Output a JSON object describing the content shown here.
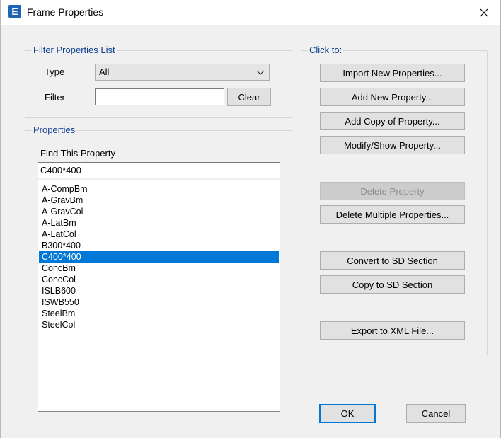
{
  "window": {
    "title": "Frame Properties",
    "app_icon_letter": "E",
    "accent_color": "#0078d7",
    "title_color": "#0b3f91"
  },
  "filter": {
    "group_label": "Filter Properties List",
    "type_label": "Type",
    "type_value": "All",
    "filter_label": "Filter",
    "filter_value": "",
    "clear_label": "Clear"
  },
  "properties": {
    "group_label": "Properties",
    "find_label": "Find This Property",
    "find_value": "C400*400",
    "items": [
      "A-CompBm",
      "A-GravBm",
      "A-GravCol",
      "A-LatBm",
      "A-LatCol",
      "B300*400",
      "C400*400",
      "ConcBm",
      "ConcCol",
      "ISLB600",
      "ISWB550",
      "SteelBm",
      "SteelCol"
    ],
    "selected": "C400*400"
  },
  "actions": {
    "group_label": "Click to:",
    "import": "Import New Properties...",
    "add_new": "Add New Property...",
    "add_copy": "Add Copy of Property...",
    "modify": "Modify/Show Property...",
    "delete": "Delete Property",
    "delete_multiple": "Delete Multiple Properties...",
    "convert_sd": "Convert to SD Section",
    "copy_sd": "Copy to SD Section",
    "export_xml": "Export to XML File..."
  },
  "footer": {
    "ok": "OK",
    "cancel": "Cancel"
  }
}
